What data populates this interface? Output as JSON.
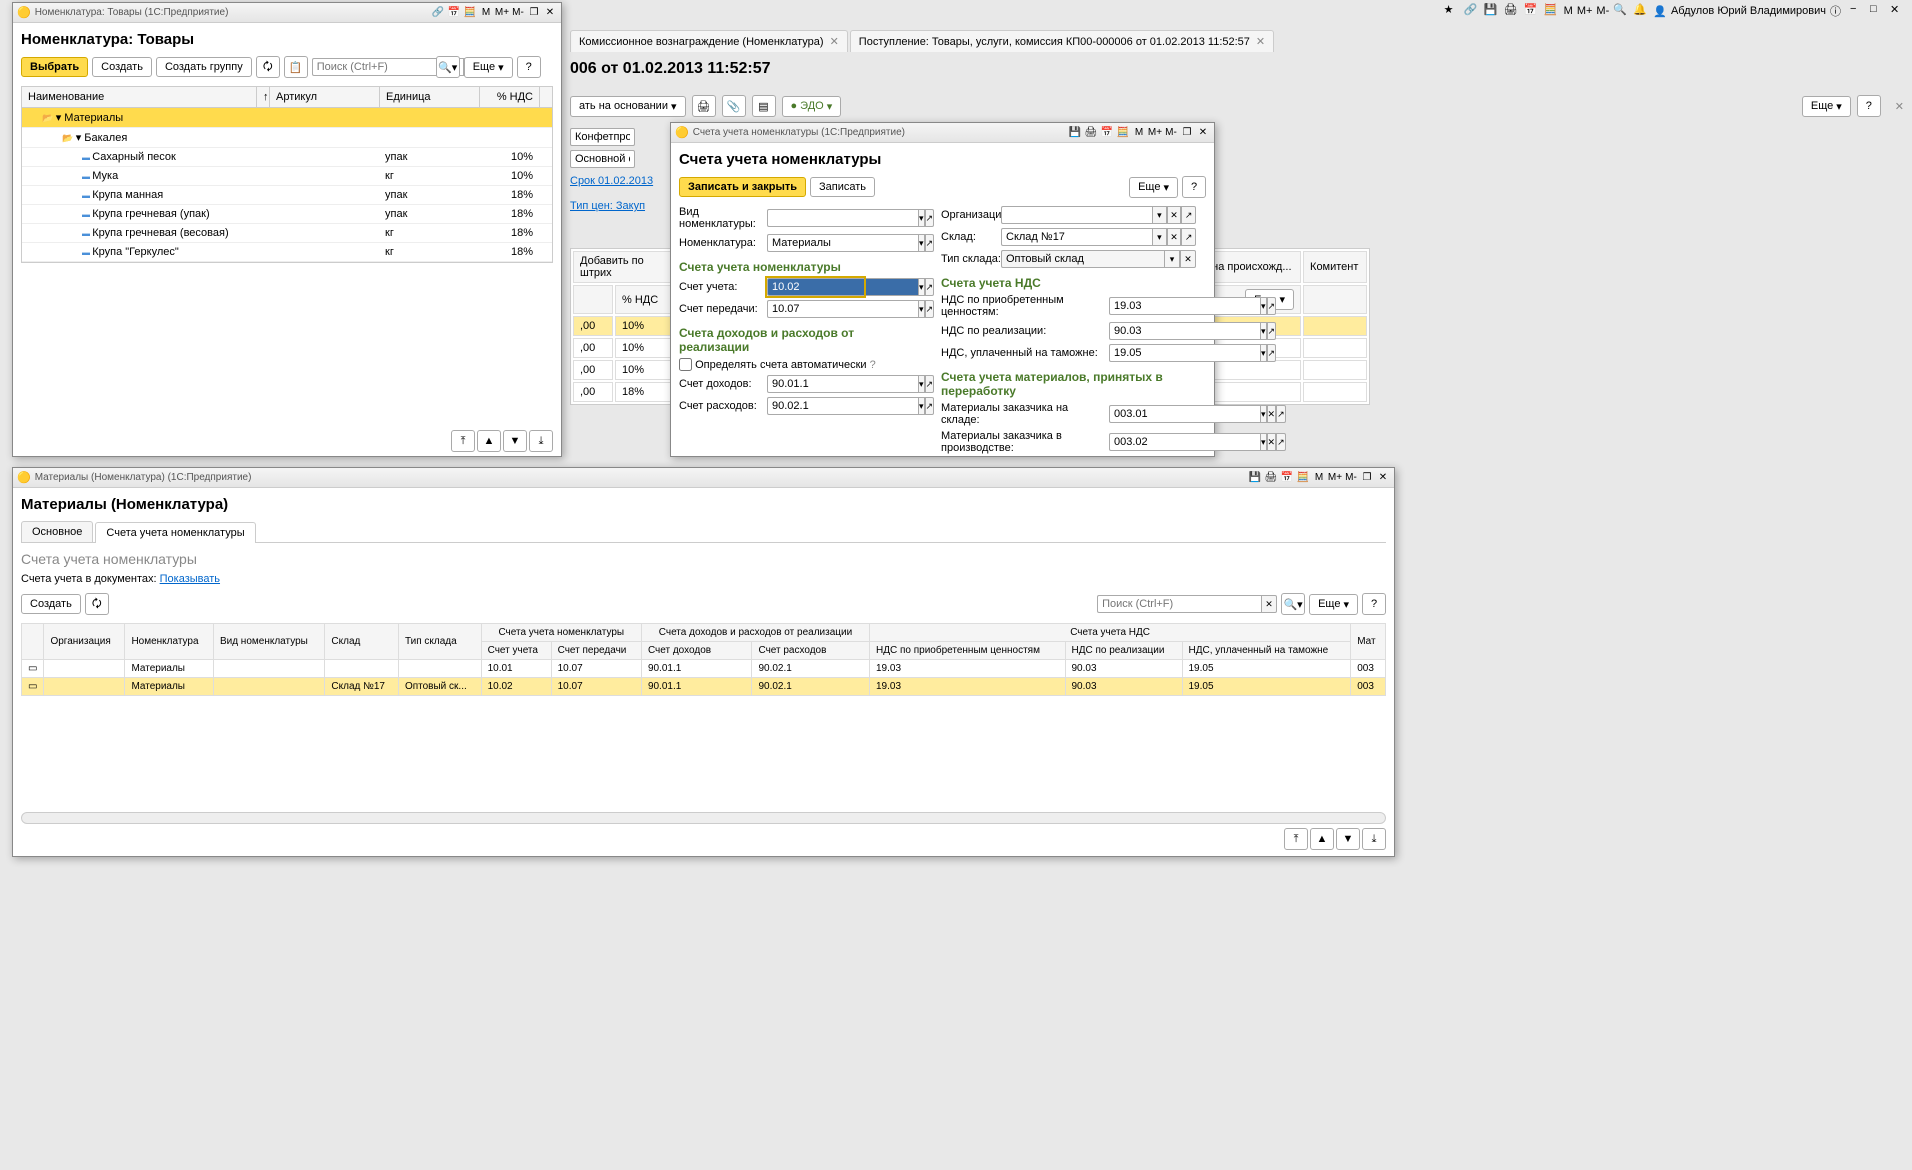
{
  "topbar": {
    "user": "Абдулов Юрий Владимирович"
  },
  "bgTabs": [
    {
      "label": "Комиссионное вознаграждение (Номенклатура)"
    },
    {
      "label": "Поступление: Товары, услуги, комиссия КП00-000006 от 01.02.2013 11:52:57"
    }
  ],
  "bgTitle": "006 от 01.02.2013 11:52:57",
  "bgToolbar": {
    "basedOn": "ать на основании",
    "edo": "ЭДО",
    "more": "Еще"
  },
  "bgFields": {
    "org": "Конфетпром",
    "warehouse": "Основной склад",
    "term": "Срок 01.02.2013",
    "priceType": "Тип цен: Закуп",
    "addBarcode": "Добавить по штрих",
    "vatCol": "% НДС",
    "moreBtn": "Еще"
  },
  "bgRows": [
    {
      "sum": ",00",
      "vat": "10%"
    },
    {
      "sum": ",00",
      "vat": "10%"
    },
    {
      "sum": ",00",
      "vat": "10%"
    },
    {
      "sum": ",00",
      "vat": "18%"
    }
  ],
  "bgExtra": {
    "origin": "ана происхожд...",
    "committent": "Комитент"
  },
  "nom": {
    "winTitle": "Номенклатура: Товары  (1С:Предприятие)",
    "title": "Номенклатура: Товары",
    "toolbar": {
      "select": "Выбрать",
      "create": "Создать",
      "createGroup": "Создать группу",
      "searchPh": "Поиск (Ctrl+F)",
      "more": "Еще"
    },
    "cols": {
      "name": "Наименование",
      "article": "Артикул",
      "unit": "Единица",
      "vat": "% НДС"
    },
    "tree": [
      {
        "lv": 0,
        "type": "fld",
        "name": "Материалы",
        "sel": true
      },
      {
        "lv": 1,
        "type": "fld",
        "name": "Бакалея"
      },
      {
        "lv": 2,
        "type": "itm",
        "name": "Сахарный песок",
        "unit": "упак",
        "vat": "10%"
      },
      {
        "lv": 2,
        "type": "itm",
        "name": "Мука",
        "unit": "кг",
        "vat": "10%"
      },
      {
        "lv": 2,
        "type": "itm",
        "name": "Крупа манная",
        "unit": "упак",
        "vat": "18%"
      },
      {
        "lv": 2,
        "type": "itm",
        "name": "Крупа гречневая (упак)",
        "unit": "упак",
        "vat": "18%"
      },
      {
        "lv": 2,
        "type": "itm",
        "name": "Крупа гречневая (весовая)",
        "unit": "кг",
        "vat": "18%"
      },
      {
        "lv": 2,
        "type": "itm",
        "name": "Крупа \"Геркулес\"",
        "unit": "кг",
        "vat": "18%"
      }
    ]
  },
  "acc": {
    "winTitle": "Счета учета номенклатуры  (1С:Предприятие)",
    "title": "Счета учета номенклатуры",
    "toolbar": {
      "saveClose": "Записать и закрыть",
      "save": "Записать",
      "more": "Еще"
    },
    "labels": {
      "kind": "Вид номенклатуры:",
      "org": "Организация:",
      "nom": "Номенклатура:",
      "warehouse": "Склад:",
      "whType": "Тип склада:",
      "secAcc": "Счета учета номенклатуры",
      "account": "Счет учета:",
      "transfer": "Счет передачи:",
      "secVat": "Счета учета НДС",
      "vatAcq": "НДС по приобретенным ценностям:",
      "vatSale": "НДС по реализации:",
      "vatCustoms": "НДС, уплаченный на таможне:",
      "secIncome": "Счета доходов и расходов от реализации",
      "auto": "Определять счета автоматически",
      "income": "Счет доходов:",
      "expense": "Счет расходов:",
      "secMat": "Счета учета материалов, принятых в переработку",
      "matWh": "Материалы заказчика на складе:",
      "matProd": "Материалы заказчика в производстве:"
    },
    "values": {
      "nom": "Материалы",
      "warehouse": "Склад №17",
      "whType": "Оптовый склад",
      "account": "10.02",
      "transfer": "10.07",
      "vatAcq": "19.03",
      "vatSale": "90.03",
      "vatCustoms": "19.05",
      "income": "90.01.1",
      "expense": "90.02.1",
      "matWh": "003.01",
      "matProd": "003.02"
    }
  },
  "mat": {
    "winTitle": "Материалы (Номенклатура)  (1С:Предприятие)",
    "title": "Материалы (Номенклатура)",
    "tabs": {
      "main": "Основное",
      "accounts": "Счета учета номенклатуры"
    },
    "subtitle": "Счета учета номенклатуры",
    "docAccounts": {
      "label": "Счета учета в документах:",
      "link": "Показывать"
    },
    "toolbar": {
      "create": "Создать",
      "searchPh": "Поиск (Ctrl+F)",
      "more": "Еще"
    },
    "cols": {
      "org": "Организация",
      "nom": "Номенклатура",
      "kind": "Вид номенклатуры",
      "wh": "Склад",
      "whType": "Тип склада",
      "gAcc": "Счета учета номенклатуры",
      "account": "Счет учета",
      "transfer": "Счет передачи",
      "gInc": "Счета доходов и расходов от реализации",
      "income": "Счет доходов",
      "expense": "Счет расходов",
      "gVat": "Счета учета НДС",
      "vatAcq": "НДС по приобретенным ценностям",
      "vatSale": "НДС по реализации",
      "vatCustoms": "НДС, уплаченный на таможне",
      "matExtra": "Мат"
    },
    "rows": [
      {
        "nom": "Материалы",
        "wh": "",
        "whType": "",
        "account": "10.01",
        "transfer": "10.07",
        "income": "90.01.1",
        "expense": "90.02.1",
        "vatAcq": "19.03",
        "vatSale": "90.03",
        "vatCustoms": "19.05",
        "mat": "003"
      },
      {
        "nom": "Материалы",
        "wh": "Склад №17",
        "whType": "Оптовый ск...",
        "account": "10.02",
        "transfer": "10.07",
        "income": "90.01.1",
        "expense": "90.02.1",
        "vatAcq": "19.03",
        "vatSale": "90.03",
        "vatCustoms": "19.05",
        "mat": "003",
        "sel": true
      }
    ]
  }
}
